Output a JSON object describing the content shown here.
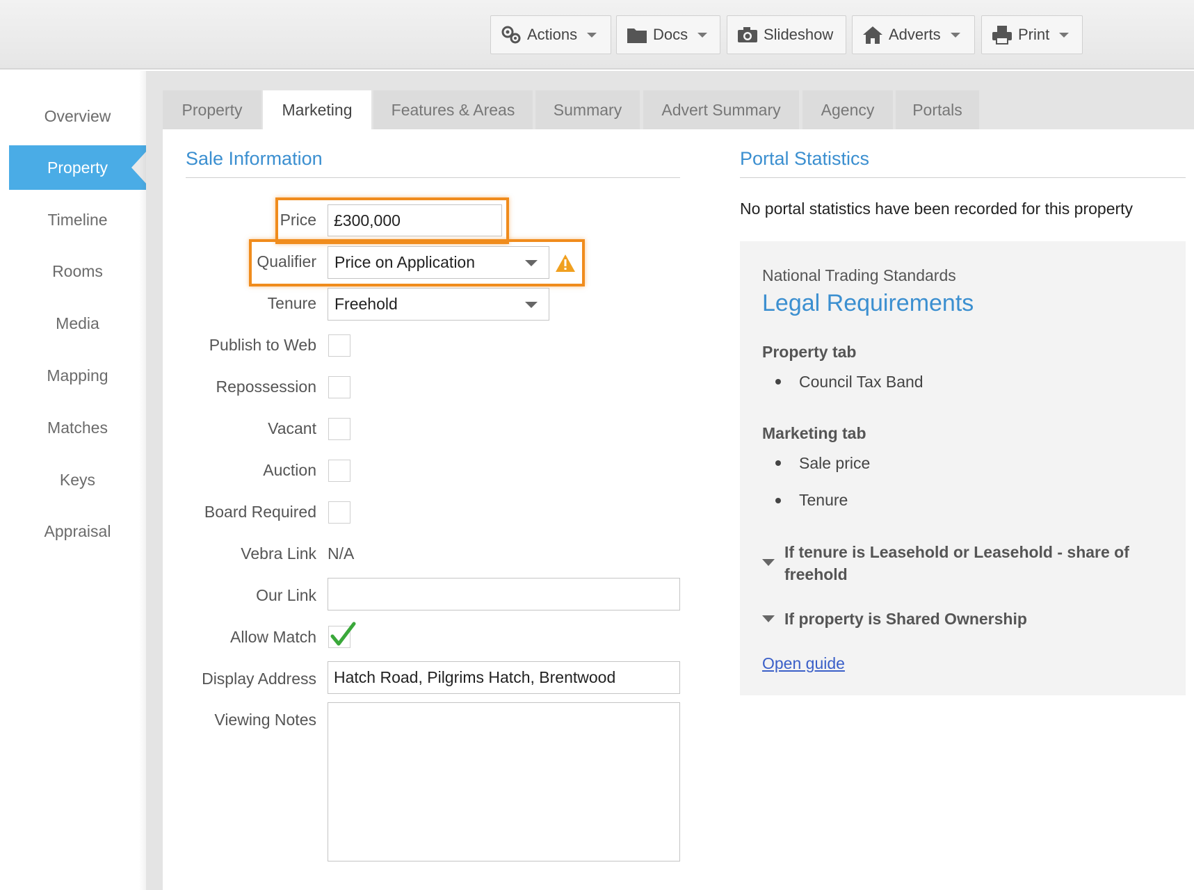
{
  "toolbar": {
    "actions_label": "Actions",
    "docs_label": "Docs",
    "slideshow_label": "Slideshow",
    "adverts_label": "Adverts",
    "print_label": "Print"
  },
  "nav": {
    "items": [
      "Overview",
      "Property",
      "Timeline",
      "Rooms",
      "Media",
      "Mapping",
      "Matches",
      "Keys",
      "Appraisal"
    ],
    "active": "Property"
  },
  "tabs": {
    "items": [
      "Property",
      "Marketing",
      "Features & Areas",
      "Summary",
      "Advert Summary",
      "Agency",
      "Portals"
    ],
    "active": "Marketing"
  },
  "sale": {
    "title": "Sale Information",
    "price_label": "Price",
    "price_value": "£300,000",
    "qualifier_label": "Qualifier",
    "qualifier_value": "Price on Application",
    "tenure_label": "Tenure",
    "tenure_value": "Freehold",
    "publish_label": "Publish to Web",
    "publish_checked": false,
    "repossession_label": "Repossession",
    "repossession_checked": false,
    "vacant_label": "Vacant",
    "vacant_checked": false,
    "auction_label": "Auction",
    "auction_checked": false,
    "board_label": "Board Required",
    "board_checked": false,
    "vebra_label": "Vebra Link",
    "vebra_value": "N/A",
    "ourlink_label": "Our Link",
    "ourlink_value": "",
    "allowmatch_label": "Allow Match",
    "allowmatch_checked": true,
    "address_label": "Display Address",
    "address_value": "Hatch Road, Pilgrims Hatch, Brentwood",
    "viewing_label": "Viewing Notes",
    "viewing_value": ""
  },
  "portal": {
    "title": "Portal Statistics",
    "empty_text": "No portal statistics have been recorded for this property"
  },
  "legal": {
    "kicker": "National Trading Standards",
    "title": "Legal Requirements",
    "property_tab_heading": "Property tab",
    "property_tab_items": [
      "Council Tax Band"
    ],
    "marketing_tab_heading": "Marketing tab",
    "marketing_tab_items": [
      "Sale price",
      "Tenure"
    ],
    "leasehold_line1": "If tenure is Leasehold or Leasehold - share of",
    "leasehold_line2": "freehold",
    "shared_ownership": "If property is Shared Ownership",
    "guide_link": "Open guide"
  },
  "colors": {
    "accent": "#3b8fd0",
    "active_nav": "#4aace6",
    "highlight": "#f08c1d",
    "warning": "#f0a020",
    "check": "#3aa83a"
  }
}
